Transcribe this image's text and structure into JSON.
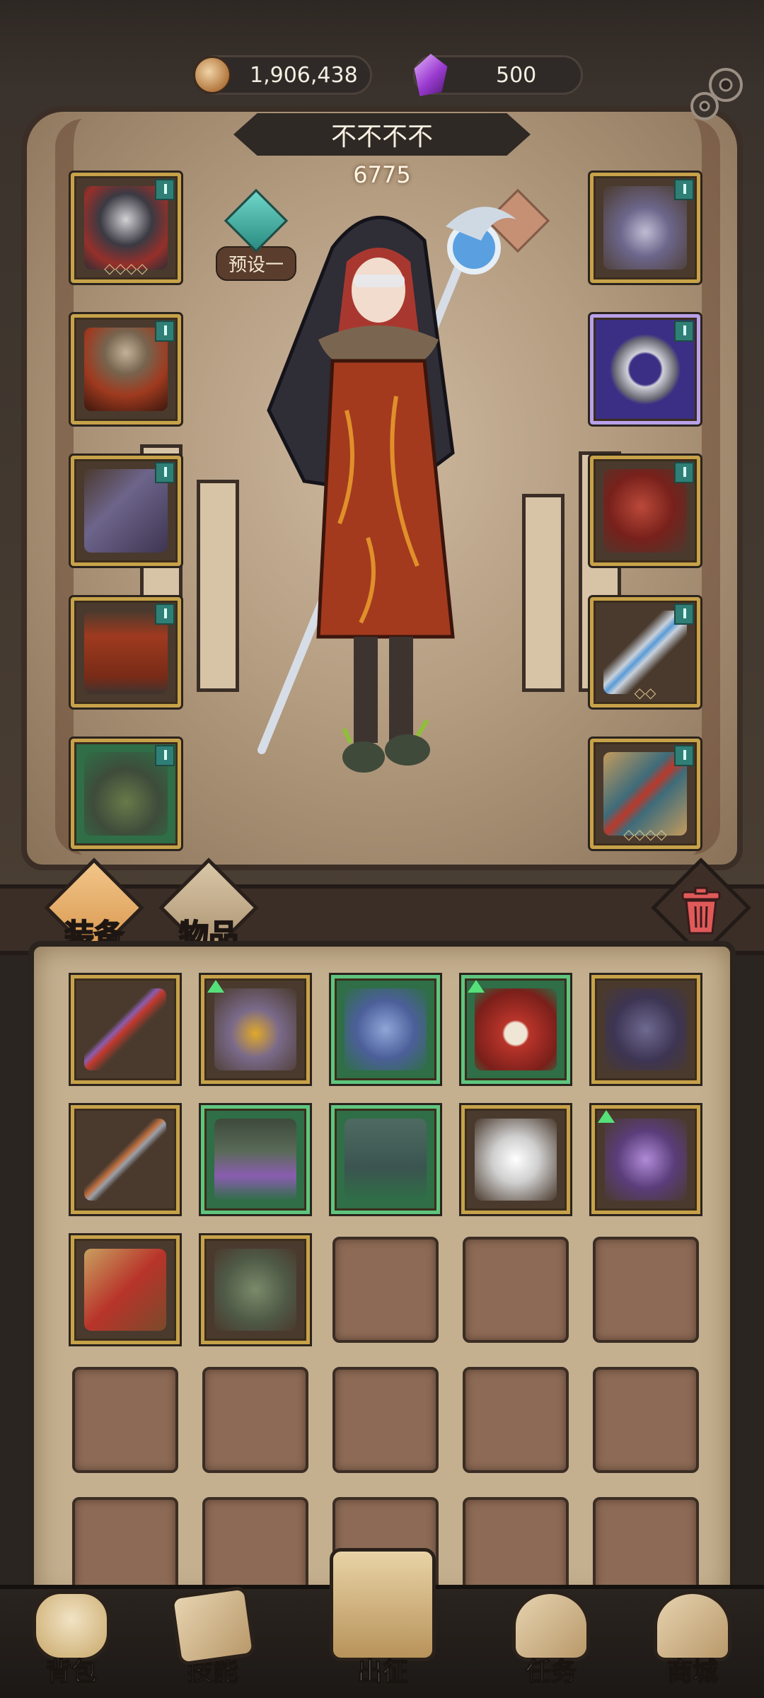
{
  "currency": {
    "coins": "1,906,438",
    "gems": "500"
  },
  "player": {
    "name": "不不不不",
    "power": "6775"
  },
  "preset": {
    "label": "预设一"
  },
  "equipment": {
    "left": [
      {
        "name": "hood-helmet",
        "badge": true,
        "stars": "◇◇◇◇"
      },
      {
        "name": "fur-cloak-armor",
        "badge": true,
        "stars": ""
      },
      {
        "name": "gauntlet",
        "badge": true,
        "stars": ""
      },
      {
        "name": "robe-pants",
        "badge": true,
        "stars": ""
      },
      {
        "name": "leaf-boots",
        "badge": true,
        "stars": ""
      }
    ],
    "right": [
      {
        "name": "moon-amulet",
        "badge": true,
        "stars": ""
      },
      {
        "name": "silver-ring",
        "badge": true,
        "stars": ""
      },
      {
        "name": "crimson-pauldron",
        "badge": true,
        "stars": ""
      },
      {
        "name": "crystal-staff",
        "badge": true,
        "stars": "◇◇"
      },
      {
        "name": "tarot-book",
        "badge": true,
        "stars": "◇◇◇◇"
      }
    ]
  },
  "inventory": {
    "tabs": {
      "equip": "装备",
      "items": "物品"
    },
    "items": [
      {
        "name": "scepter",
        "quality": "gold",
        "upgrade": false
      },
      {
        "name": "plague-mask",
        "quality": "gold",
        "upgrade": true
      },
      {
        "name": "armored-boots",
        "quality": "green",
        "upgrade": false
      },
      {
        "name": "red-hood",
        "quality": "green",
        "upgrade": true
      },
      {
        "name": "thorn-cloak",
        "quality": "gold",
        "upgrade": false
      },
      {
        "name": "spear",
        "quality": "gold",
        "upgrade": false
      },
      {
        "name": "potion-belt",
        "quality": "green",
        "upgrade": false
      },
      {
        "name": "green-shorts",
        "quality": "green",
        "upgrade": false
      },
      {
        "name": "feather-mantle",
        "quality": "gold",
        "upgrade": false
      },
      {
        "name": "spirit-wolf",
        "quality": "gold",
        "upgrade": true
      },
      {
        "name": "spellbook",
        "quality": "gold",
        "upgrade": false
      },
      {
        "name": "mossy-charm",
        "quality": "gold",
        "upgrade": false
      }
    ]
  },
  "nav": {
    "backpack": "背包",
    "skills": "技能",
    "expedition": "出征",
    "quests": "任务",
    "shop": "商城"
  }
}
